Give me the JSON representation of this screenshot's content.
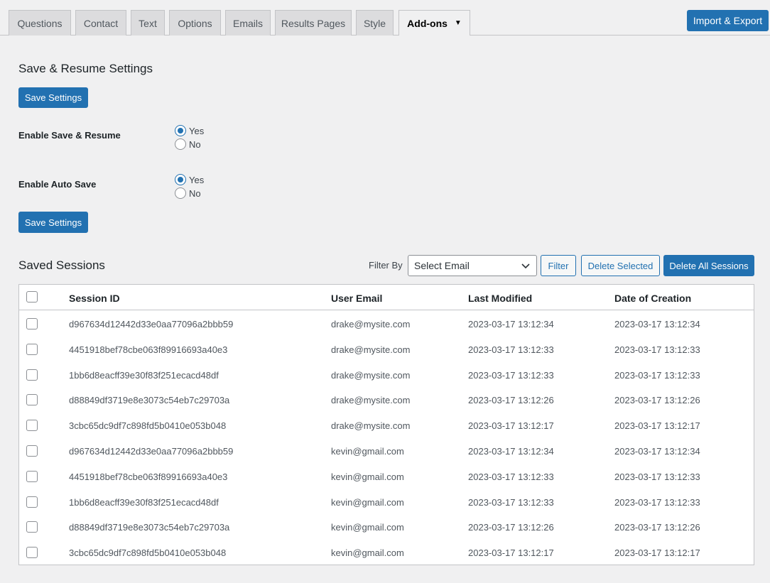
{
  "tabs": [
    {
      "label": "Questions"
    },
    {
      "label": "Contact"
    },
    {
      "label": "Text"
    },
    {
      "label": "Options"
    },
    {
      "label": "Emails"
    },
    {
      "label": "Results Pages"
    },
    {
      "label": "Style"
    },
    {
      "label": "Add-ons",
      "active": true
    }
  ],
  "header": {
    "import_export_label": "Import & Export"
  },
  "settings": {
    "title": "Save & Resume Settings",
    "save_label": "Save Settings",
    "enable_save_resume": {
      "label": "Enable Save & Resume",
      "yes": "Yes",
      "no": "No",
      "selected": "Yes"
    },
    "enable_auto_save": {
      "label": "Enable Auto Save",
      "yes": "Yes",
      "no": "No",
      "selected": "Yes"
    }
  },
  "sessions": {
    "title": "Saved Sessions",
    "filter_by_label": "Filter By",
    "select_value": "Select Email",
    "filter_button": "Filter",
    "delete_selected_button": "Delete Selected",
    "delete_all_button": "Delete All Sessions",
    "columns": [
      "Session ID",
      "User Email",
      "Last Modified",
      "Date of Creation"
    ],
    "rows": [
      {
        "id": "d967634d12442d33e0aa77096a2bbb59",
        "email": "drake@mysite.com",
        "modified": "2023-03-17 13:12:34",
        "created": "2023-03-17 13:12:34"
      },
      {
        "id": "4451918bef78cbe063f89916693a40e3",
        "email": "drake@mysite.com",
        "modified": "2023-03-17 13:12:33",
        "created": "2023-03-17 13:12:33"
      },
      {
        "id": "1bb6d8eacff39e30f83f251ecacd48df",
        "email": "drake@mysite.com",
        "modified": "2023-03-17 13:12:33",
        "created": "2023-03-17 13:12:33"
      },
      {
        "id": "d88849df3719e8e3073c54eb7c29703a",
        "email": "drake@mysite.com",
        "modified": "2023-03-17 13:12:26",
        "created": "2023-03-17 13:12:26"
      },
      {
        "id": "3cbc65dc9df7c898fd5b0410e053b048",
        "email": "drake@mysite.com",
        "modified": "2023-03-17 13:12:17",
        "created": "2023-03-17 13:12:17"
      },
      {
        "id": "d967634d12442d33e0aa77096a2bbb59",
        "email": "kevin@gmail.com",
        "modified": "2023-03-17 13:12:34",
        "created": "2023-03-17 13:12:34"
      },
      {
        "id": "4451918bef78cbe063f89916693a40e3",
        "email": "kevin@gmail.com",
        "modified": "2023-03-17 13:12:33",
        "created": "2023-03-17 13:12:33"
      },
      {
        "id": "1bb6d8eacff39e30f83f251ecacd48df",
        "email": "kevin@gmail.com",
        "modified": "2023-03-17 13:12:33",
        "created": "2023-03-17 13:12:33"
      },
      {
        "id": "d88849df3719e8e3073c54eb7c29703a",
        "email": "kevin@gmail.com",
        "modified": "2023-03-17 13:12:26",
        "created": "2023-03-17 13:12:26"
      },
      {
        "id": "3cbc65dc9df7c898fd5b0410e053b048",
        "email": "kevin@gmail.com",
        "modified": "2023-03-17 13:12:17",
        "created": "2023-03-17 13:12:17"
      }
    ]
  },
  "colors": {
    "accent": "#2271b1",
    "background": "#f0f0f1"
  }
}
